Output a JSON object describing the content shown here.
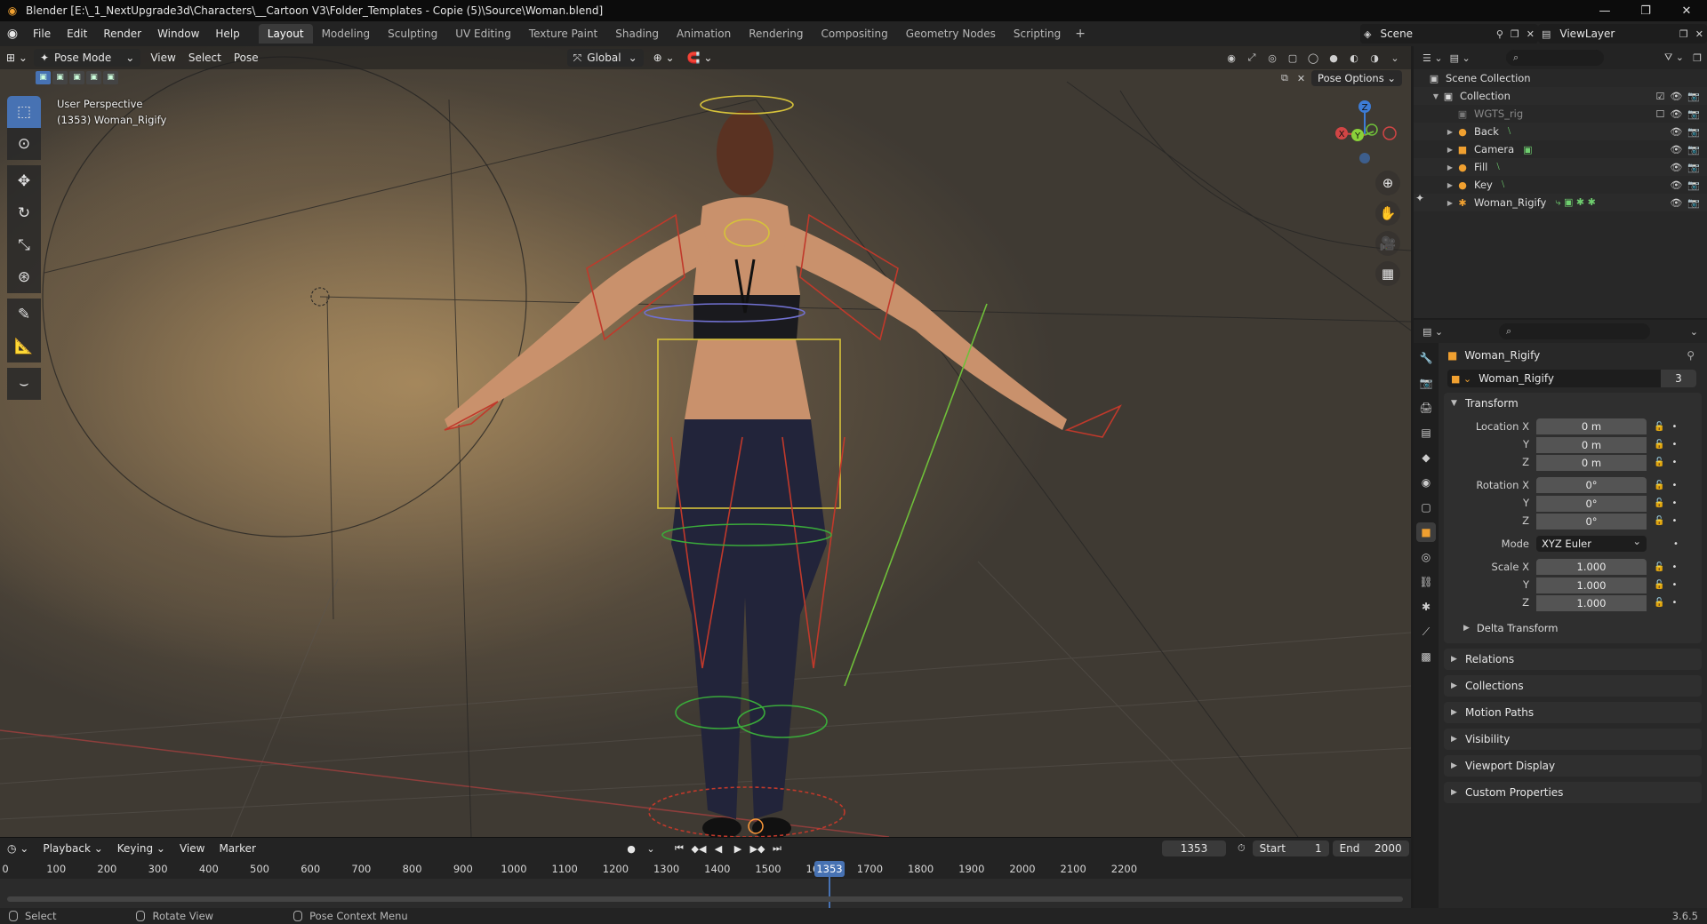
{
  "titlebar": {
    "title": "Blender [E:\\_1_NextUpgrade3d\\Characters\\__Cartoon V3\\Folder_Templates - Copie (5)\\Source\\Woman.blend]",
    "minimize": "—",
    "maximize": "❐",
    "close": "✕"
  },
  "menus": [
    "File",
    "Edit",
    "Render",
    "Window",
    "Help"
  ],
  "workspaces": [
    "Layout",
    "Modeling",
    "Sculpting",
    "UV Editing",
    "Texture Paint",
    "Shading",
    "Animation",
    "Rendering",
    "Compositing",
    "Geometry Nodes",
    "Scripting"
  ],
  "active_workspace": "Layout",
  "scene": "Scene",
  "view_layer": "ViewLayer",
  "viewport": {
    "mode": "Pose Mode",
    "menus": [
      "View",
      "Select",
      "Pose"
    ],
    "orientation": "Global",
    "pose_options": "Pose Options",
    "info_line1": "User Perspective",
    "info_line2": "(1353) Woman_Rigify",
    "gizmo": {
      "x": "X",
      "y": "Y",
      "z": "Z"
    }
  },
  "timeline": {
    "menus": [
      "Playback",
      "Keying",
      "View",
      "Marker"
    ],
    "current_frame": "1353",
    "start_label": "Start",
    "start": "1",
    "end_label": "End",
    "end": "2000",
    "ruler": [
      "0",
      "100",
      "200",
      "300",
      "400",
      "500",
      "600",
      "700",
      "800",
      "900",
      "1000",
      "1100",
      "1200",
      "1300",
      "1400",
      "1500",
      "1600",
      "1700",
      "1800",
      "1900",
      "2000",
      "2100",
      "2200"
    ]
  },
  "statusbar": {
    "select": "Select",
    "rotate": "Rotate View",
    "context": "Pose Context Menu",
    "version": "3.6.5"
  },
  "outliner": {
    "root": "Scene Collection",
    "collection": "Collection",
    "items": [
      {
        "name": "WGTS_rig",
        "dim": true
      },
      {
        "name": "Back"
      },
      {
        "name": "Camera"
      },
      {
        "name": "Fill"
      },
      {
        "name": "Key"
      },
      {
        "name": "Woman_Rigify"
      }
    ]
  },
  "properties": {
    "object_name": "Woman_Rigify",
    "data_name": "Woman_Rigify",
    "user_count": "3",
    "transform": {
      "header": "Transform",
      "location_label": "Location X",
      "y_label": "Y",
      "z_label": "Z",
      "location": [
        "0 m",
        "0 m",
        "0 m"
      ],
      "rotation_label": "Rotation X",
      "rotation": [
        "0°",
        "0°",
        "0°"
      ],
      "mode_label": "Mode",
      "mode": "XYZ Euler",
      "scale_label": "Scale X",
      "scale": [
        "1.000",
        "1.000",
        "1.000"
      ],
      "delta": "Delta Transform"
    },
    "panels": [
      "Relations",
      "Collections",
      "Motion Paths",
      "Visibility",
      "Viewport Display",
      "Custom Properties"
    ]
  },
  "colors": {
    "accent": "#4772b3",
    "object_orange": "#f0a030",
    "bone_green": "#6fcf6f"
  }
}
